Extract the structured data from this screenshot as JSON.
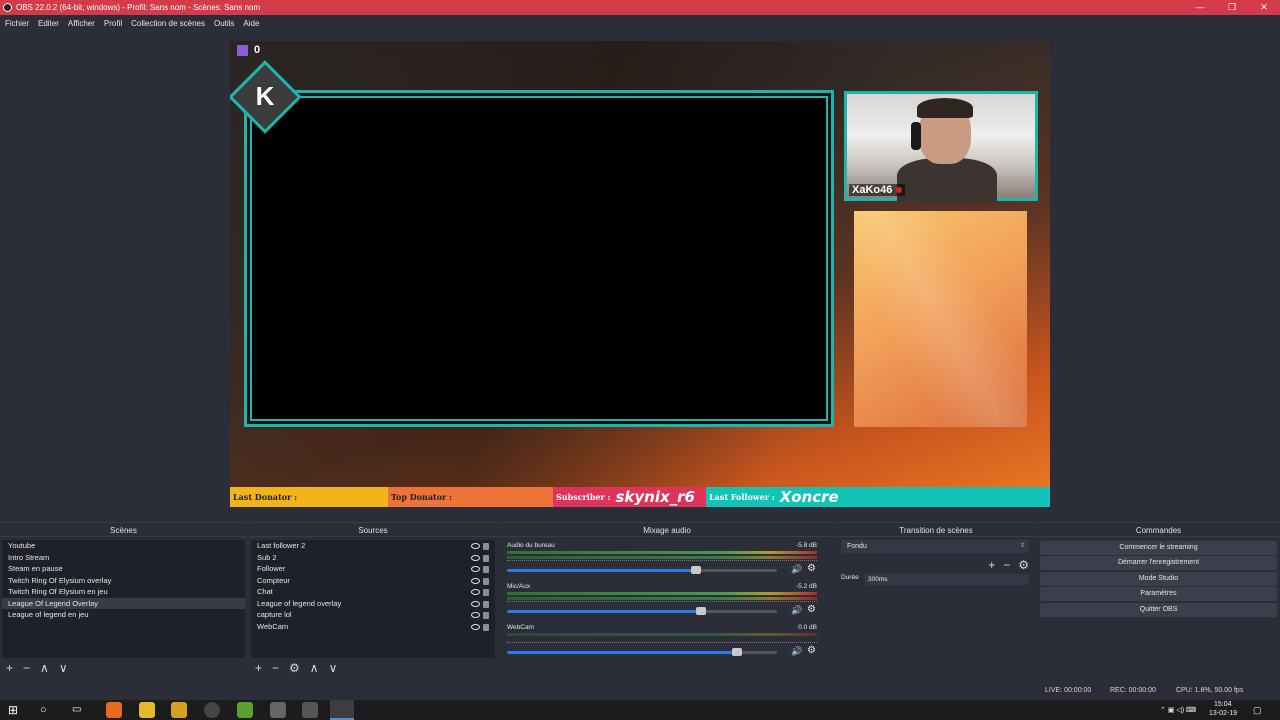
{
  "window": {
    "title": "OBS 22.0.2 (64-bit, windows) - Profil: Sans nom - Scènes: Sans nom",
    "buttons": [
      "—",
      "❐",
      "✕"
    ]
  },
  "menu": [
    "Fichier",
    "Editer",
    "Afficher",
    "Profil",
    "Collection de scènes",
    "Outils",
    "Aide"
  ],
  "preview": {
    "twitch_count": "0",
    "logo_letter": "K",
    "cam_name": "XaKo46",
    "bar": {
      "last_donator": "Last Donator :",
      "top_donator": "Top Donator :",
      "subscriber_label": "Subscriber :",
      "subscriber_name": "skynix_r6",
      "follower_label": "Last Follower :",
      "follower_name": "Xoncre"
    }
  },
  "docks": {
    "scenes": {
      "title": "Scènes",
      "items": [
        "Youtube",
        "Intro Stream",
        "Steam en pause",
        "Twitch Ring Of Elysium overlay",
        "Twitch Ring Of Elysium en jeu",
        "League Of Legend Overlay",
        "League of legend en jeu"
      ],
      "selected_index": 5,
      "toolbar": [
        "+",
        "−",
        "∧",
        "∨"
      ]
    },
    "sources": {
      "title": "Sources",
      "items": [
        "Last follower 2",
        "Sub 2",
        "Follower",
        "Compteur",
        "Chat",
        "League of legend overlay",
        "capture lol",
        "WebCam"
      ],
      "toolbar": [
        "+",
        "−",
        "⚙",
        "∧",
        "∨"
      ]
    },
    "mixer": {
      "title": "Mixage audio",
      "channels": [
        {
          "name": "Audio du bureau",
          "db": "-5.8 dB",
          "level": 0.7
        },
        {
          "name": "Mic/Aux",
          "db": "-5.2 dB",
          "level": 0.72
        },
        {
          "name": "WebCam",
          "db": "0.0 dB",
          "level": 0.85
        }
      ]
    },
    "transitions": {
      "title": "Transition de scènes",
      "selected": "Fondu",
      "duration_label": "Durée",
      "duration_value": "300ms"
    },
    "commands": {
      "title": "Commandes",
      "buttons": [
        "Commencer le streaming",
        "Démarrer l'enregistrement",
        "Mode Studio",
        "Paramètres",
        "Quitter OBS"
      ]
    }
  },
  "status": {
    "live": "LIVE: 00:00:00",
    "rec": "REC: 00:00:00",
    "cpu": "CPU: 1.8%, 50.00 fps"
  },
  "taskbar": {
    "time": "15:04",
    "date": "13-02-19"
  },
  "colors": {
    "titlebar": "#d33a4a",
    "accent_teal": "#1fb5ad",
    "volume_blue": "#2c7be5"
  }
}
